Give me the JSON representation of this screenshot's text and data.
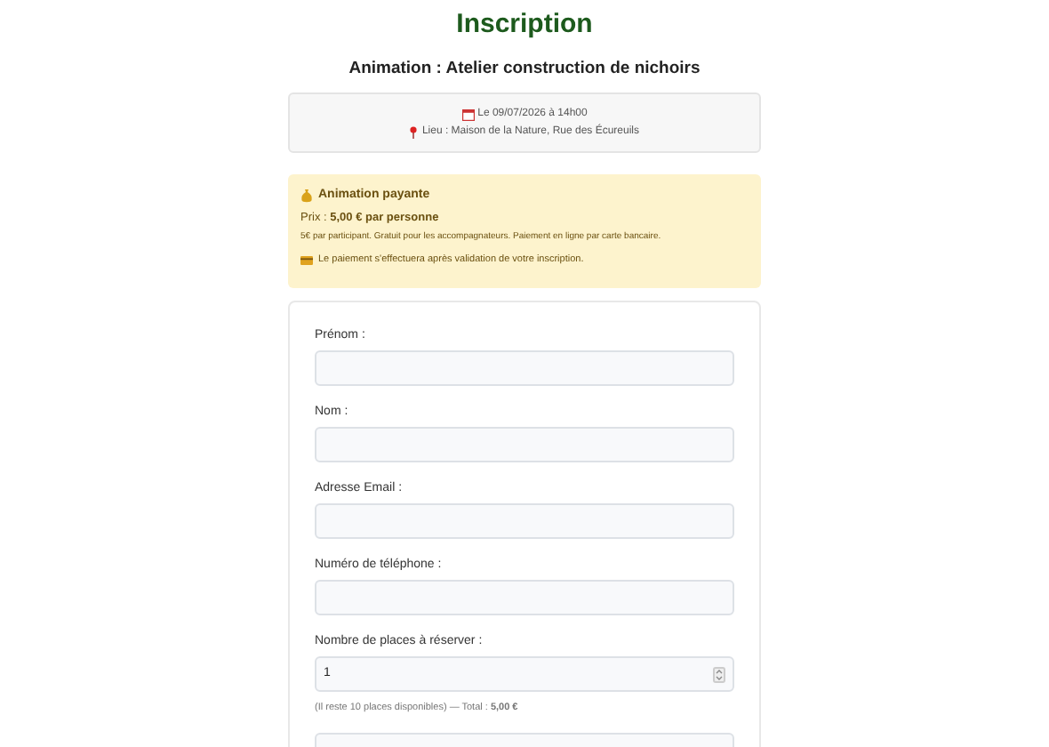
{
  "title": "Inscription",
  "subtitle": "Animation : Atelier construction de nichoirs",
  "event": {
    "date": "Le 09/07/2026 à 14h00",
    "place": "Lieu : Maison de la Nature, Rue des Écureuils"
  },
  "payment": {
    "heading": "Animation payante",
    "price": "Prix : **5,00 € par personne**",
    "details": "5€ par participant. Gratuit pour les accompagnateurs. Paiement en ligne par carte bancaire.",
    "note": "Le paiement s'effectuera après validation de votre inscription."
  },
  "fields": [
    {
      "kind": "text",
      "label": "Prénom :"
    },
    {
      "kind": "text",
      "label": "Nom :"
    },
    {
      "kind": "text",
      "label": "Adresse Email :"
    },
    {
      "kind": "text",
      "label": "Numéro de téléphone :"
    },
    {
      "kind": "number",
      "label": "Nombre de places à réserver :",
      "value": "1",
      "hint": "(Il reste 10 places disponibles) — Total : **5,00 €**"
    }
  ]
}
